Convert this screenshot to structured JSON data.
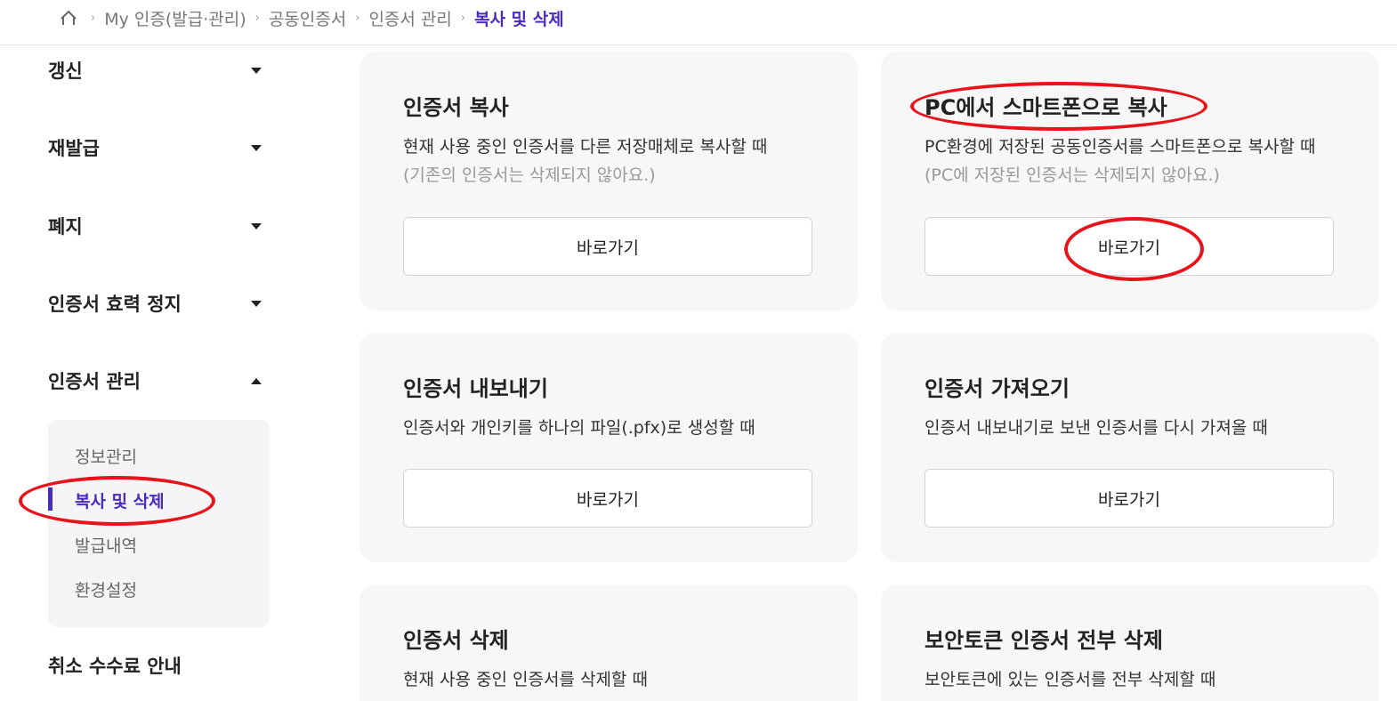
{
  "breadcrumb": {
    "items": [
      "My 인증(발급·관리)",
      "공동인증서",
      "인증서 관리"
    ],
    "current": "복사 및 삭제"
  },
  "sidebar": {
    "menu": [
      {
        "label": "갱신",
        "state": "collapsed"
      },
      {
        "label": "재발급",
        "state": "collapsed"
      },
      {
        "label": "폐지",
        "state": "collapsed"
      },
      {
        "label": "인증서 효력 정지",
        "state": "collapsed"
      },
      {
        "label": "인증서 관리",
        "state": "expanded"
      }
    ],
    "submenu": [
      "정보관리",
      "복사 및 삭제",
      "발급내역",
      "환경설정"
    ],
    "active_submenu": "복사 및 삭제",
    "bottom_item": "취소 수수료 안내"
  },
  "cards": [
    {
      "title": "인증서 복사",
      "desc": "현재 사용 중인 인증서를 다른 저장매체로 복사할 때",
      "note": "(기존의 인증서는 삭제되지 않아요.)",
      "button": "바로가기"
    },
    {
      "title": "PC에서 스마트폰으로 복사",
      "desc": "PC환경에 저장된 공동인증서를 스마트폰으로 복사할 때",
      "note": "(PC에 저장된 인증서는 삭제되지 않아요.)",
      "button": "바로가기"
    },
    {
      "title": "인증서 내보내기",
      "desc": "인증서와 개인키를 하나의 파일(.pfx)로 생성할 때",
      "button": "바로가기"
    },
    {
      "title": "인증서 가져오기",
      "desc": "인증서 내보내기로 보낸 인증서를 다시 가져올 때",
      "button": "바로가기"
    },
    {
      "title": "인증서 삭제",
      "desc": "현재 사용 중인 인증서를 삭제할 때"
    },
    {
      "title": "보안토큰 인증서 전부 삭제",
      "desc": "보안토큰에 있는 인증서를 전부 삭제할 때"
    }
  ],
  "colors": {
    "accent": "#4a2bbf",
    "highlight": "#e8141b",
    "card_bg": "#f7f7f7"
  },
  "icons": {
    "home": "home-icon",
    "separator": "chevron-right-icon",
    "caret_down": "caret-down-icon",
    "caret_up": "caret-up-icon"
  }
}
